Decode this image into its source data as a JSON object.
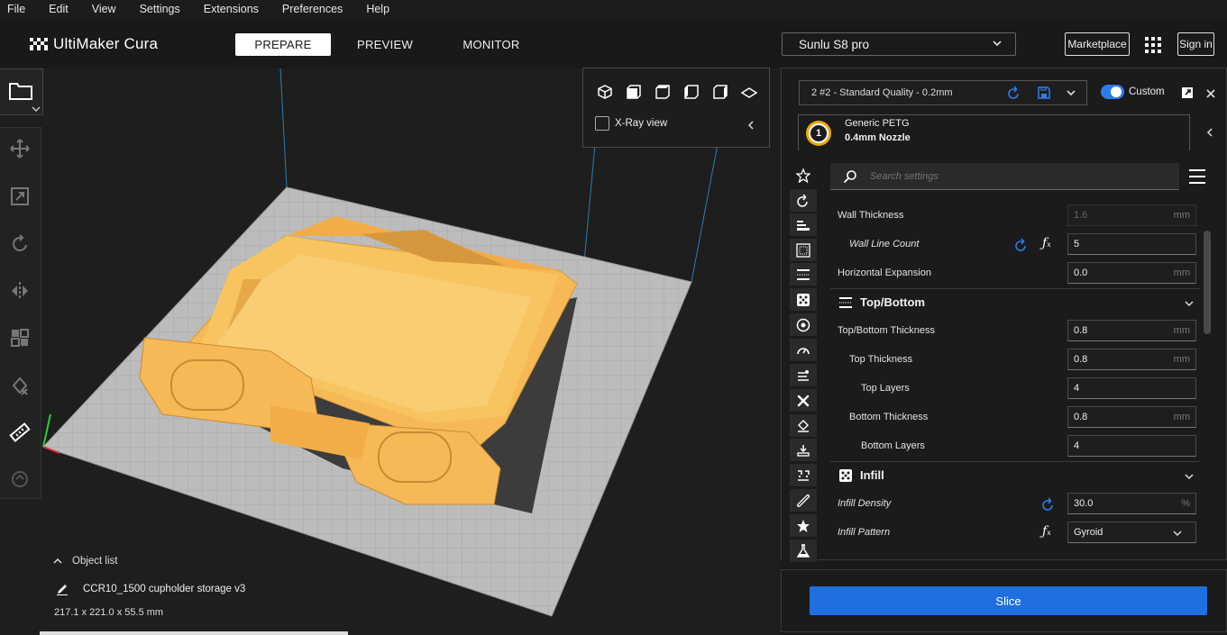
{
  "menu": [
    "File",
    "Edit",
    "View",
    "Settings",
    "Extensions",
    "Preferences",
    "Help"
  ],
  "header": {
    "logo_text": "UltiMaker Cura",
    "tabs": [
      "PREPARE",
      "PREVIEW",
      "MONITOR"
    ],
    "active_tab": "PREPARE",
    "printer": "Sunlu S8 pro",
    "marketplace": "Marketplace",
    "signin": "Sign in"
  },
  "view_panel": {
    "xray_label": "X-Ray view"
  },
  "object": {
    "list_label": "Object list",
    "name": "CCR10_1500 cupholder storage v3",
    "dimensions": "217.1 x 221.0 x 55.5 mm"
  },
  "profile": {
    "name": "2 #2 - Standard Quality - 0.2mm",
    "mode": "Custom",
    "extruder_number": "1",
    "material": "Generic PETG",
    "nozzle": "0.4mm Nozzle"
  },
  "search": {
    "placeholder": "Search settings"
  },
  "settings": {
    "wall_thickness": {
      "label": "Wall Thickness",
      "value": "1.6",
      "unit": "mm"
    },
    "wall_line_count": {
      "label": "Wall Line Count",
      "value": "5"
    },
    "horizontal_expansion": {
      "label": "Horizontal Expansion",
      "value": "0.0",
      "unit": "mm"
    },
    "topbottom_section": "Top/Bottom",
    "topbottom_thickness": {
      "label": "Top/Bottom Thickness",
      "value": "0.8",
      "unit": "mm"
    },
    "top_thickness": {
      "label": "Top Thickness",
      "value": "0.8",
      "unit": "mm"
    },
    "top_layers": {
      "label": "Top Layers",
      "value": "4"
    },
    "bottom_thickness": {
      "label": "Bottom Thickness",
      "value": "0.8",
      "unit": "mm"
    },
    "bottom_layers": {
      "label": "Bottom Layers",
      "value": "4"
    },
    "infill_section": "Infill",
    "infill_density": {
      "label": "Infill Density",
      "value": "30.0",
      "unit": "%"
    },
    "infill_pattern": {
      "label": "Infill Pattern",
      "value": "Gyroid"
    }
  },
  "slice_button": "Slice",
  "colors": {
    "accent": "#1f6fe0",
    "toggle": "#2b7de9",
    "model": "#f7c15e",
    "plate": "#b9b9b9"
  }
}
